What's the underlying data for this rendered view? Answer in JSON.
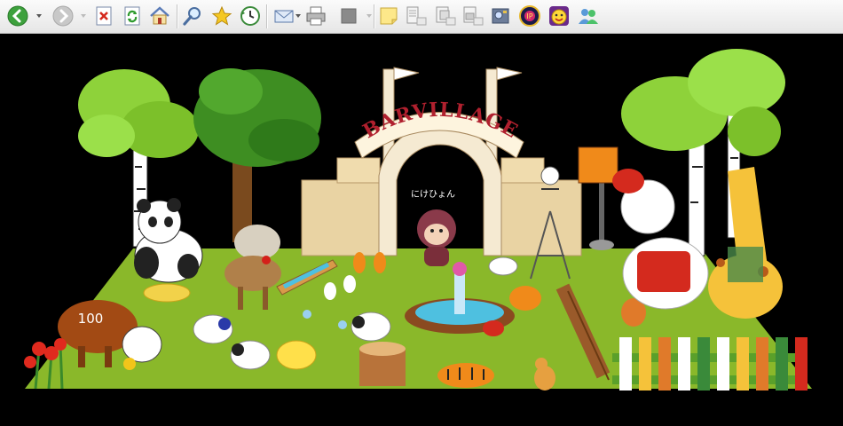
{
  "toolbar": {
    "buttons": [
      {
        "name": "back-button",
        "icon": "arrow-left-icon",
        "enabled": true
      },
      {
        "name": "forward-button",
        "icon": "arrow-right-icon",
        "enabled": false
      },
      {
        "name": "stop-button",
        "icon": "stop-x-icon",
        "enabled": true
      },
      {
        "name": "refresh-button",
        "icon": "refresh-icon",
        "enabled": true
      },
      {
        "name": "home-button",
        "icon": "home-icon",
        "enabled": true
      },
      {
        "name": "search-button",
        "icon": "magnifier-icon",
        "enabled": true
      },
      {
        "name": "favorites-button",
        "icon": "star-icon",
        "enabled": true
      },
      {
        "name": "history-button",
        "icon": "history-clock-icon",
        "enabled": true
      },
      {
        "name": "mail-button",
        "icon": "envelope-icon",
        "enabled": true
      },
      {
        "name": "print-button",
        "icon": "printer-icon",
        "enabled": true
      },
      {
        "name": "edit-button",
        "icon": "edit-icon",
        "enabled": false
      },
      {
        "name": "note-button",
        "icon": "sticky-note-icon",
        "enabled": true
      },
      {
        "name": "page-tile-button",
        "icon": "page-tile-icon",
        "enabled": false
      },
      {
        "name": "page-cascade-button",
        "icon": "page-cascade-icon",
        "enabled": false
      },
      {
        "name": "page-split-button",
        "icon": "page-split-icon",
        "enabled": false
      },
      {
        "name": "media-button",
        "icon": "film-icon",
        "enabled": true
      },
      {
        "name": "ie-tool-button",
        "icon": "ie-badge-icon",
        "enabled": true
      },
      {
        "name": "messenger-button",
        "icon": "messenger-smiley-icon",
        "enabled": true
      },
      {
        "name": "people-button",
        "icon": "buddies-icon",
        "enabled": true
      }
    ]
  },
  "scene": {
    "sign_text": "BARVILLAGE",
    "player_name": "にけひょん",
    "cow_tag": "100"
  },
  "colors": {
    "background": "#000000",
    "grass": "#8ab82a",
    "arch": "#f5ead2",
    "sign_text": "#b0202e"
  }
}
